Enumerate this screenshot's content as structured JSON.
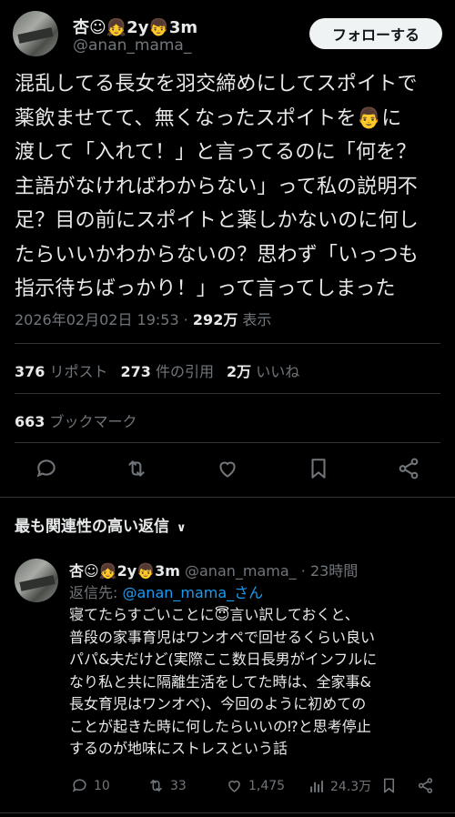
{
  "author": {
    "name": "杏☺👧2y👦3m",
    "handle": "@anan_mama_",
    "follow_label": "フォローする"
  },
  "tweet": {
    "text": "混乱してる長女を羽交締めにしてスポイトで\n薬飲ませてて、無くなったスポイトを👨に\n渡して「入れて！」と言ってるのに「何を？\n主語がなければわからない」って私の説明不\n足？目の前にスポイトと薬しかないのに何し\nたらいいかわからないの？思わず「いっつも\n指示待ちばっかり！」って言ってしまった",
    "timestamp": "2026年02月02日 19:53",
    "separator": "·",
    "views_value": "292万",
    "views_label": "表示"
  },
  "stats": {
    "reposts_value": "376",
    "reposts_label": "リポスト",
    "quotes_value": "273",
    "quotes_label": "件の引用",
    "likes_value": "2万",
    "likes_label": "いいね",
    "bookmarks_value": "663",
    "bookmarks_label": "ブックマーク"
  },
  "actions": [
    "reply-icon",
    "repost-icon",
    "like-icon",
    "bookmark-icon",
    "share-icon"
  ],
  "relevant_replies_label": "最も関連性の高い返信",
  "reply": {
    "name": "杏☺👧2y👦3m",
    "handle": "@anan_mama_",
    "time": "· 23時間",
    "reply_to_label": "返信先:",
    "reply_to_link": "@anan_mama_さん",
    "text": "寝てたらすごいことに😇言い訳しておくと、\n普段の家事育児はワンオペで回せるくらい良い\nパパ&夫だけど(実際ここ数日長男がインフルに\nなり私と共に隔離生活をしてた時は、全家事&\n長女育児はワンオペ)、今回のように初めての\nことが起きた時に何したらいいの⁉と思考停止\nするのが地味にストレスという話",
    "replies": "10",
    "reposts": "33",
    "likes": "1,475",
    "views": "24.3万"
  },
  "colors": {
    "background": "#000000",
    "text": "#e7e9ea",
    "muted": "#71767b",
    "link": "#1d9bf0",
    "divider": "#2f3336"
  }
}
